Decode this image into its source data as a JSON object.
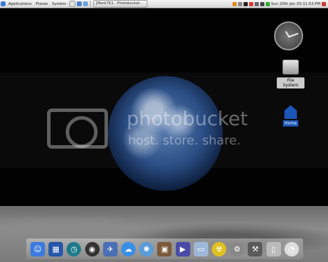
{
  "panel": {
    "menus": [
      "Applications",
      "Places",
      "System"
    ],
    "task": "[Mark761 - Photobucket -",
    "clock": "Sun 20th Jan 03:11:53 PM"
  },
  "desktop": {
    "file_system_label": "File System",
    "home_label": "Home"
  },
  "watermark": {
    "brand": "photobucket",
    "tagline": "host. store. share."
  },
  "dock": {
    "icons": [
      {
        "name": "finder-icon",
        "color": "#3b7be0",
        "glyph": "☺"
      },
      {
        "name": "workspaces-icon",
        "color": "#2457a8",
        "glyph": "▦"
      },
      {
        "name": "time-machine-icon",
        "color": "#1e7a8a",
        "glyph": "◷"
      },
      {
        "name": "dashboard-icon",
        "color": "#333333",
        "glyph": "◉"
      },
      {
        "name": "preview-icon",
        "color": "#4a6fb5",
        "glyph": "✈"
      },
      {
        "name": "ichat-icon",
        "color": "#3a8ee6",
        "glyph": "☁"
      },
      {
        "name": "safari-icon",
        "color": "#5a9bd8",
        "glyph": "✺"
      },
      {
        "name": "iphoto-icon",
        "color": "#7b5a3a",
        "glyph": "▣"
      },
      {
        "name": "movie-icon",
        "color": "#4a4aa8",
        "glyph": "▶"
      },
      {
        "name": "applications-folder-icon",
        "color": "#9fb8d9",
        "glyph": "▭"
      },
      {
        "name": "radiation-icon",
        "color": "#e0c020",
        "glyph": "☢"
      },
      {
        "name": "system-preferences-icon",
        "color": "#888888",
        "glyph": "⚙"
      },
      {
        "name": "utility-icon",
        "color": "#5a5a5a",
        "glyph": "⚒"
      },
      {
        "name": "trash-icon",
        "color": "#bbbbbb",
        "glyph": "▯"
      },
      {
        "name": "clock-icon",
        "color": "#dddddd",
        "glyph": "◔"
      }
    ]
  },
  "colors": {
    "panel": "#dcdcdc",
    "home_blue": "#1c56b8"
  }
}
